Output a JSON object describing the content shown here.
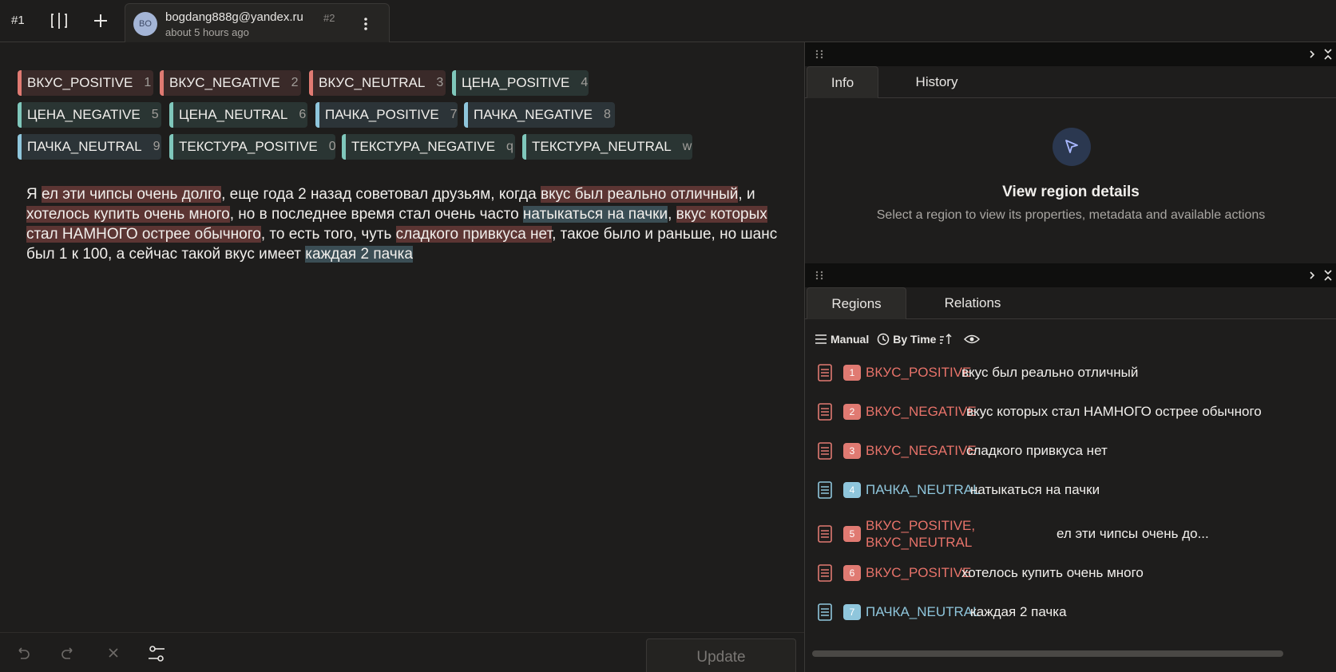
{
  "topbar": {
    "annotation_number": "#1",
    "user_email": "bogdang888g@yandex.ru",
    "annotation_id": "#2",
    "timestamp": "about 5 hours ago",
    "avatar_initials": "BO"
  },
  "labels": [
    {
      "name": "ВКУС_POSITIVE",
      "hotkey": "1",
      "color": "red"
    },
    {
      "name": "ВКУС_NEGATIVE",
      "hotkey": "2",
      "color": "red"
    },
    {
      "name": "ВКУС_NEUTRAL",
      "hotkey": "3",
      "color": "red"
    },
    {
      "name": "ЦЕНА_POSITIVE",
      "hotkey": "4",
      "color": "teal"
    },
    {
      "name": "ЦЕНА_NEGATIVE",
      "hotkey": "5",
      "color": "teal"
    },
    {
      "name": "ЦЕНА_NEUTRAL",
      "hotkey": "6",
      "color": "teal"
    },
    {
      "name": "ПАЧКА_POSITIVE",
      "hotkey": "7",
      "color": "blue"
    },
    {
      "name": "ПАЧКА_NEGATIVE",
      "hotkey": "8",
      "color": "blue"
    },
    {
      "name": "ПАЧКА_NEUTRAL",
      "hotkey": "9",
      "color": "blue"
    },
    {
      "name": "ТЕКСТУРА_POSITIVE",
      "hotkey": "0",
      "color": "teal"
    },
    {
      "name": "ТЕКСТУРА_NEGATIVE",
      "hotkey": "q",
      "color": "teal"
    },
    {
      "name": "ТЕКСТУРА_NEUTRAL",
      "hotkey": "w",
      "color": "teal"
    }
  ],
  "text_segments": [
    {
      "t": "Я ",
      "hl": ""
    },
    {
      "t": "ел эти чипсы очень долго",
      "hl": "red"
    },
    {
      "t": ", еще года 2 назад советовал друзьям, когда ",
      "hl": ""
    },
    {
      "t": "вкус был реально отличный",
      "hl": "red"
    },
    {
      "t": ", и ",
      "hl": ""
    },
    {
      "t": "хотелось купить очень много",
      "hl": "red"
    },
    {
      "t": ", но в последнее время стал очень часто ",
      "hl": ""
    },
    {
      "t": "натыкаться на пачки",
      "hl": "blue"
    },
    {
      "t": ", ",
      "hl": ""
    },
    {
      "t": "вкус которых стал НАМНОГО острее обычного",
      "hl": "red"
    },
    {
      "t": ", то есть того, чуть ",
      "hl": ""
    },
    {
      "t": "сладкого привкуса нет",
      "hl": "red"
    },
    {
      "t": ", такое было и раньше, но шанс был 1 к 100, а сейчас такой вкус имеет ",
      "hl": ""
    },
    {
      "t": "каждая 2 пачка",
      "hl": "blue"
    }
  ],
  "bottombar": {
    "update_label": "Update"
  },
  "info_panel": {
    "tabs": [
      "Info",
      "History"
    ],
    "title": "View region details",
    "subtitle": "Select a region to view its properties, metadata and available actions"
  },
  "regions_panel": {
    "tabs": [
      "Regions",
      "Relations"
    ],
    "toolbar": {
      "manual": "Manual",
      "sort": "By Time"
    },
    "regions": [
      {
        "num": "1",
        "label": "ВКУС_POSITIVE",
        "text": "вкус был реально отличный",
        "color": "red"
      },
      {
        "num": "2",
        "label": "ВКУС_NEGATIVE",
        "text": "вкус которых стал НАМНОГО острее обычного",
        "color": "red"
      },
      {
        "num": "3",
        "label": "ВКУС_NEGATIVE",
        "text": "сладкого привкуса нет",
        "color": "red"
      },
      {
        "num": "4",
        "label": "ПАЧКА_NEUTRAL",
        "text": "натыкаться на пачки",
        "color": "blue"
      },
      {
        "num": "5",
        "label": "ВКУС_POSITIVE,",
        "label2": "ВКУС_NEUTRAL",
        "text": "ел эти чипсы очень до...",
        "color": "red"
      },
      {
        "num": "6",
        "label": "ВКУС_POSITIVE",
        "text": "хотелось купить очень много",
        "color": "red"
      },
      {
        "num": "7",
        "label": "ПАЧКА_NEUTRAL",
        "text": "каждая 2 пачка",
        "color": "blue"
      }
    ]
  },
  "colors": {
    "accent_red": "#e07a72",
    "accent_teal": "#7fc7bb",
    "accent_blue": "#8fc6dc",
    "highlight_red": "#5c3533",
    "highlight_blue": "#3b4e55",
    "background": "#1e1d1c"
  }
}
